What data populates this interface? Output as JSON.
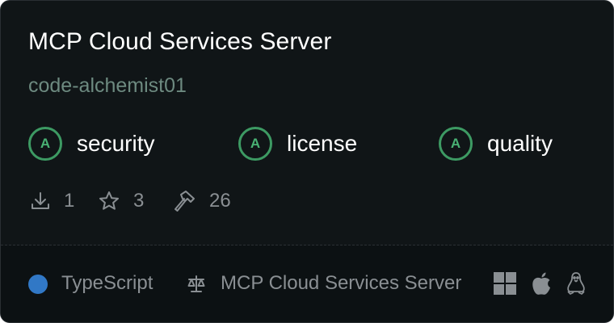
{
  "server": {
    "title": "MCP Cloud Services Server",
    "author": "code-alchemist01"
  },
  "grades": [
    {
      "grade": "A",
      "label": "security"
    },
    {
      "grade": "A",
      "label": "license"
    },
    {
      "grade": "A",
      "label": "quality"
    }
  ],
  "stats": {
    "downloads": "1",
    "stars": "3",
    "tools": "26"
  },
  "footer": {
    "language": "TypeScript",
    "license": "MCP Cloud Services Server"
  },
  "icons": {
    "downloads": "download-icon",
    "stars": "star-icon",
    "tools": "hammer-icon",
    "license": "scale-icon",
    "platforms": [
      "windows-icon",
      "apple-icon",
      "linux-icon"
    ]
  },
  "colors": {
    "background": "#101517",
    "grade_accent": "#3d9a63",
    "author": "#6d8a80",
    "language_dot": "#3178c6"
  }
}
